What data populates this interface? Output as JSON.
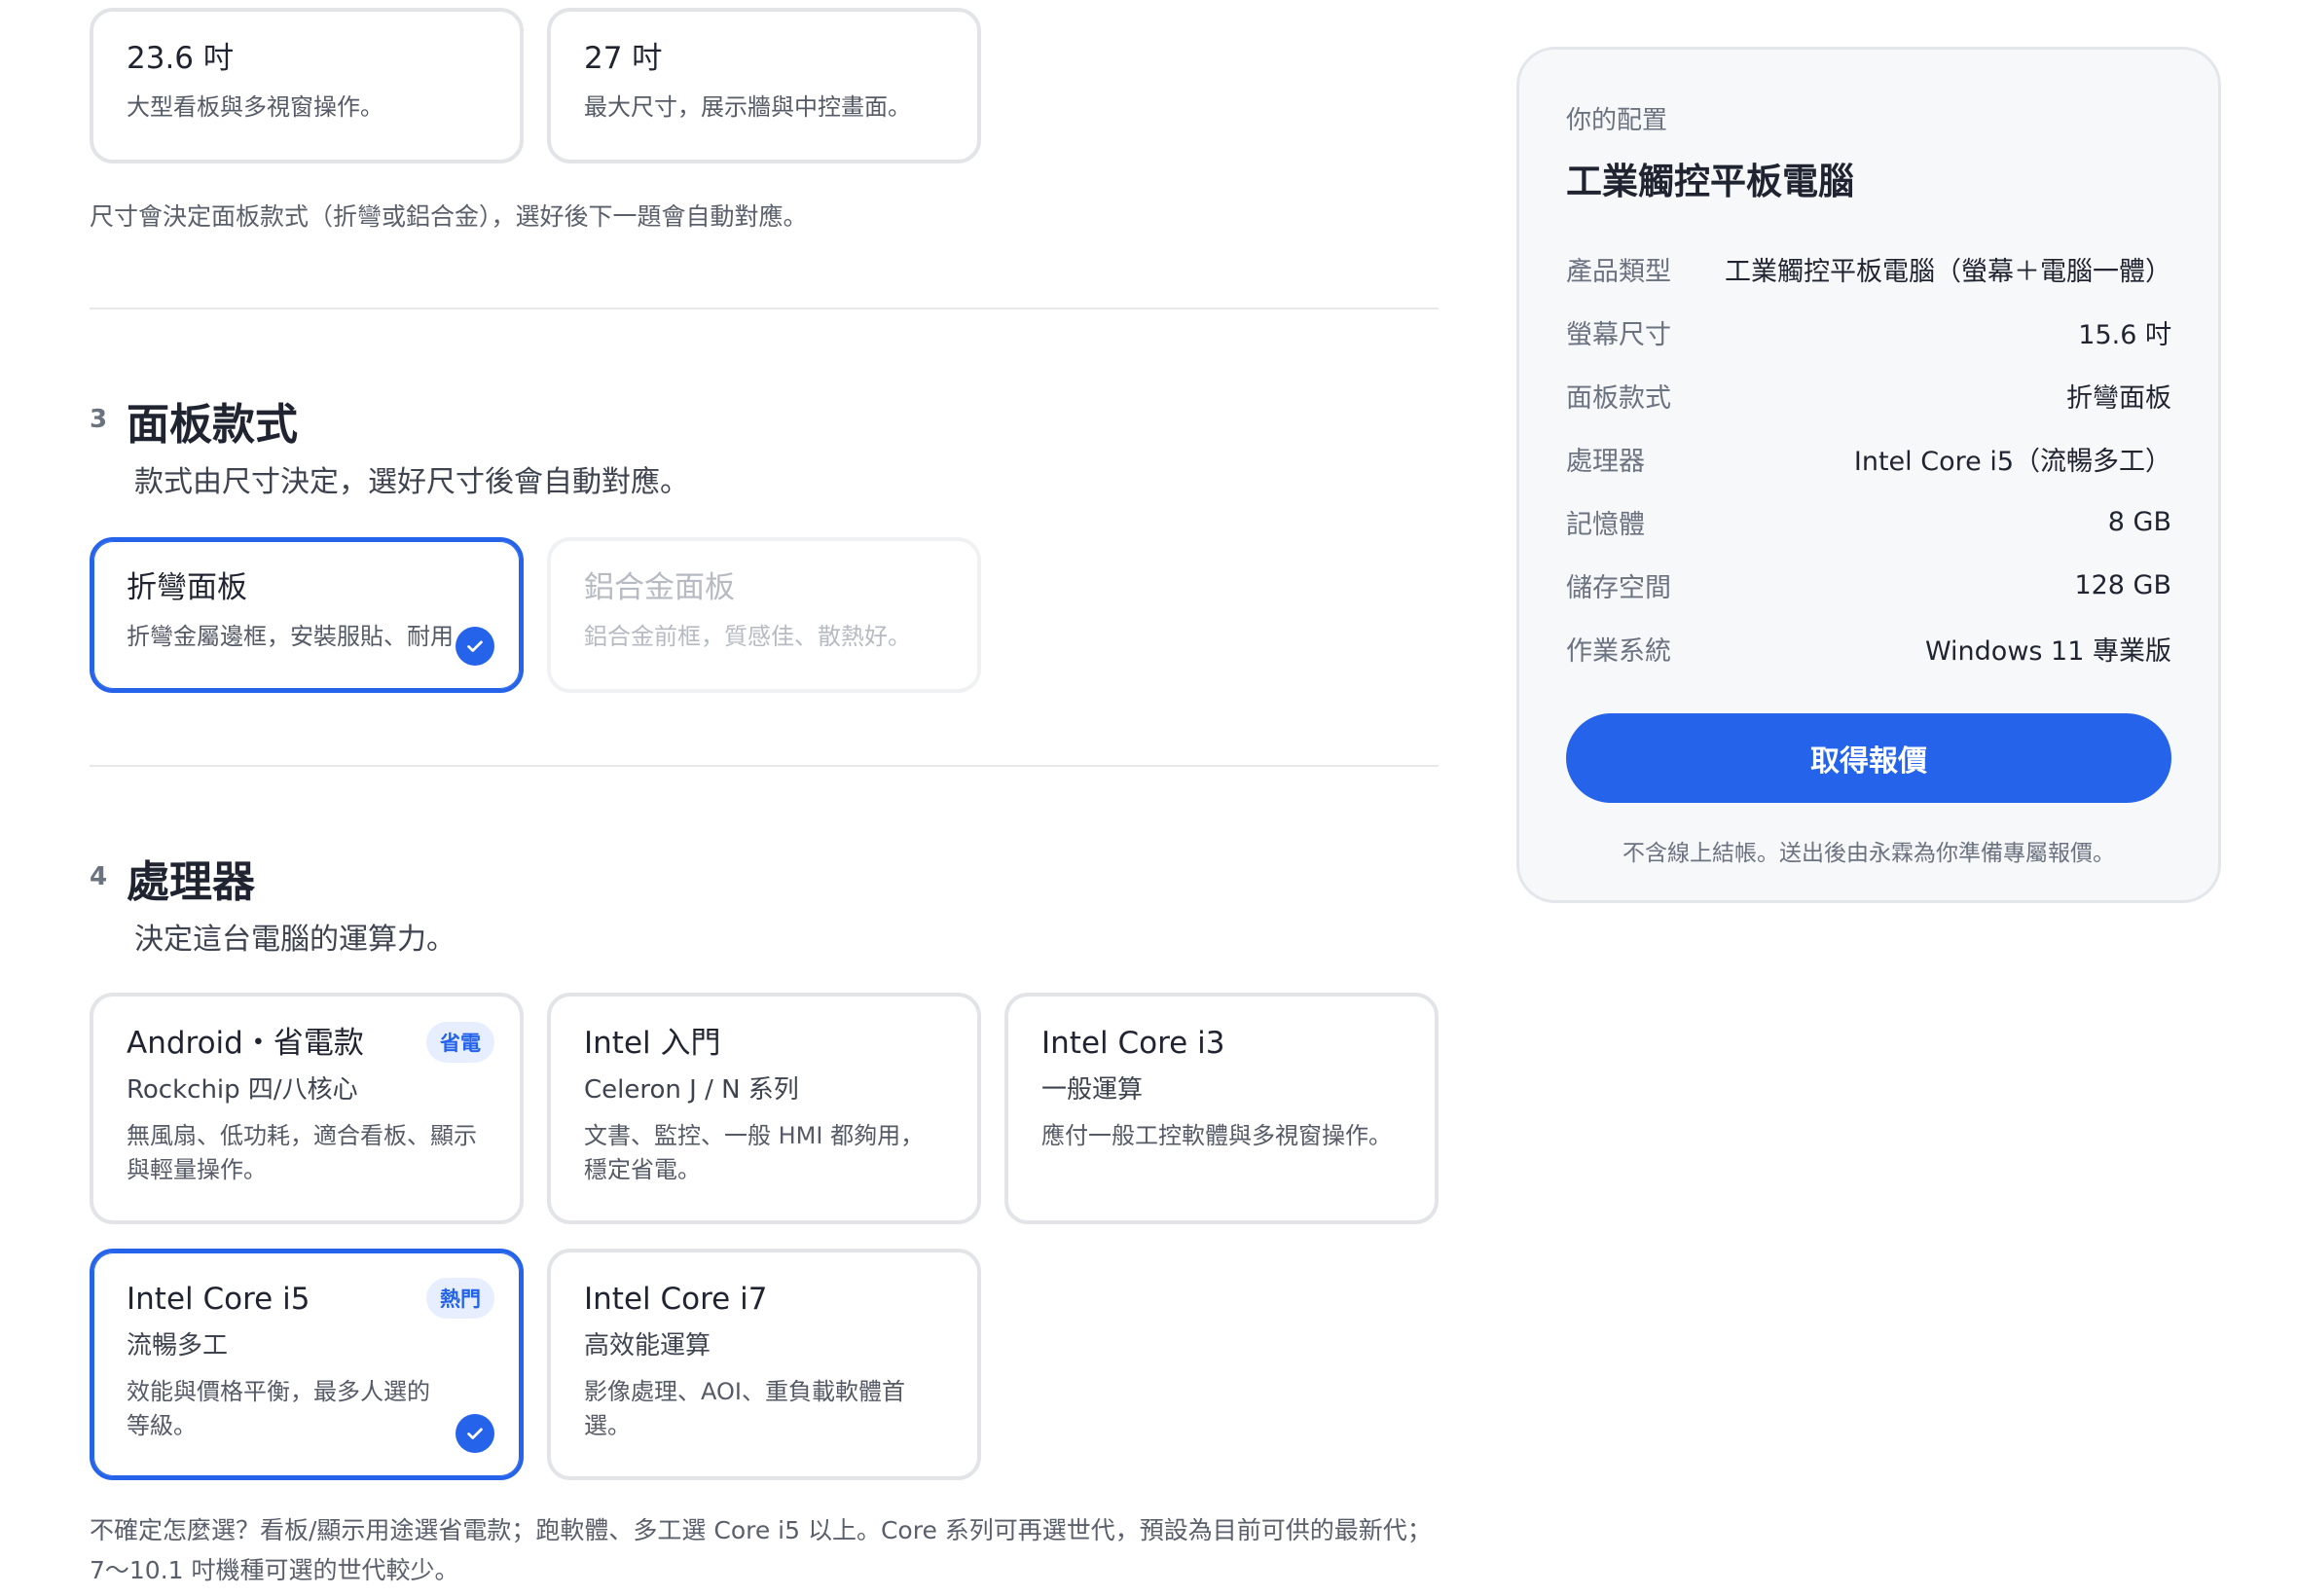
{
  "size_options": [
    {
      "title": "23.6 吋",
      "desc": "大型看板與多視窗操作。"
    },
    {
      "title": "27 吋",
      "desc": "最大尺寸，展示牆與中控畫面。"
    }
  ],
  "size_note": "尺寸會決定面板款式（折彎或鋁合金），選好後下一題會自動對應。",
  "panel_section": {
    "number": "3",
    "title": "面板款式",
    "desc": "款式由尺寸決定，選好尺寸後會自動對應。",
    "options": [
      {
        "title": "折彎面板",
        "desc": "折彎金屬邊框，安裝服貼、耐用"
      },
      {
        "title": "鋁合金面板",
        "desc": "鋁合金前框，質感佳、散熱好。"
      }
    ]
  },
  "cpu_section": {
    "number": "4",
    "title": "處理器",
    "desc": "決定這台電腦的運算力。",
    "options": [
      {
        "title": "Android・省電款",
        "sub": "Rockchip 四/八核心",
        "desc": "無風扇、低功耗，適合看板、顯示與輕量操作。",
        "badge": "省電"
      },
      {
        "title": "Intel 入門",
        "sub": "Celeron J / N 系列",
        "desc": "文書、監控、一般 HMI 都夠用，穩定省電。"
      },
      {
        "title": "Intel Core i3",
        "sub": "一般運算",
        "desc": "應付一般工控軟體與多視窗操作。"
      },
      {
        "title": "Intel Core i5",
        "sub": "流暢多工",
        "desc": "效能與價格平衡，最多人選的等級。",
        "badge": "熱門"
      },
      {
        "title": "Intel Core i7",
        "sub": "高效能運算",
        "desc": "影像處理、AOI、重負載軟體首選。"
      }
    ],
    "note": "不確定怎麼選？看板/顯示用途選省電款；跑軟體、多工選 Core i5 以上。Core 系列可再選世代，預設為目前可供的最新代；7～10.1 吋機種可選的世代較少。"
  },
  "summary": {
    "label": "你的配置",
    "title": "工業觸控平板電腦",
    "rows": [
      {
        "k": "產品類型",
        "v": "工業觸控平板電腦（螢幕＋電腦一體）"
      },
      {
        "k": "螢幕尺寸",
        "v": "15.6 吋"
      },
      {
        "k": "面板款式",
        "v": "折彎面板"
      },
      {
        "k": "處理器",
        "v": "Intel Core i5（流暢多工）"
      },
      {
        "k": "記憶體",
        "v": "8 GB"
      },
      {
        "k": "儲存空間",
        "v": "128 GB"
      },
      {
        "k": "作業系統",
        "v": "Windows 11 專業版"
      }
    ],
    "cta": "取得報價",
    "disclaimer": "不含線上結帳。送出後由永霖為你準備專屬報價。"
  }
}
